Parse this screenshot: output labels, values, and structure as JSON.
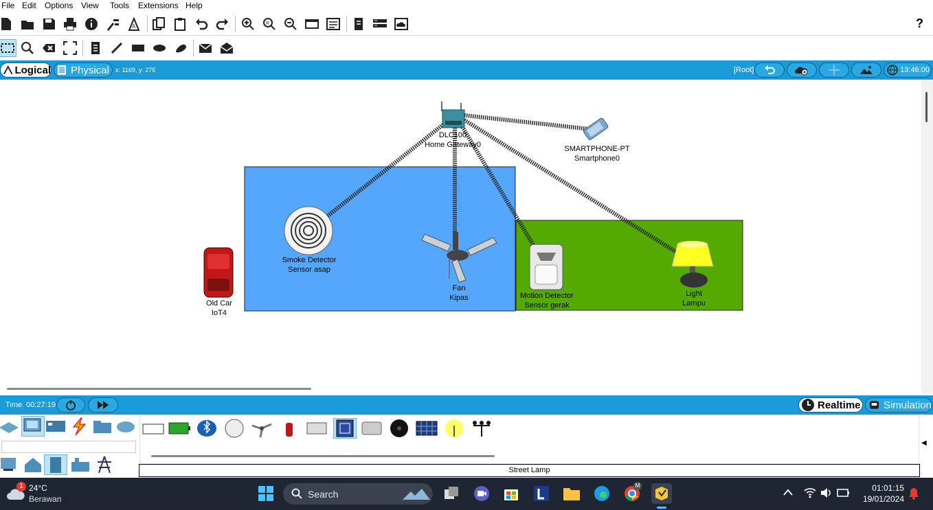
{
  "menu": [
    "File",
    "Edit",
    "Options",
    "View",
    "Tools",
    "Extensions",
    "Help"
  ],
  "help_label": "?",
  "view_tabs": {
    "logical": "Logical",
    "physical": "Physical"
  },
  "cursor_coords": "x: 1169, y: 276",
  "root_label": "[Root]",
  "clock": "13:46:00",
  "devices": {
    "gateway": {
      "model": "DLC100",
      "name": "Home Gateway0"
    },
    "smartphone": {
      "model": "SMARTPHONE-PT",
      "name": "Smartphone0"
    },
    "smoke": {
      "model": "Smoke Detector",
      "name": "Sensor asap"
    },
    "fan": {
      "model": "Fan",
      "name": "Kipas"
    },
    "car": {
      "model": "Old Car",
      "name": "IoT4"
    },
    "motion": {
      "model": "Motion Detector",
      "name": "Sensor gerak"
    },
    "light": {
      "model": "Light",
      "name": "Lampu"
    }
  },
  "zone_colors": {
    "blue": "#55a7fd",
    "green": "#55aa00"
  },
  "sim_time": "Time: 00:27:19",
  "mode_buttons": {
    "realtime": "Realtime",
    "simulation": "Simulation"
  },
  "selected_device_name": "Street Lamp",
  "taskbar": {
    "weather_temp": "24°C",
    "weather_desc": "Berawan",
    "weather_badge": "1",
    "search_label": "Search",
    "chrome_badge": "M",
    "time": "01:01:15",
    "date": "19/01/2024"
  }
}
